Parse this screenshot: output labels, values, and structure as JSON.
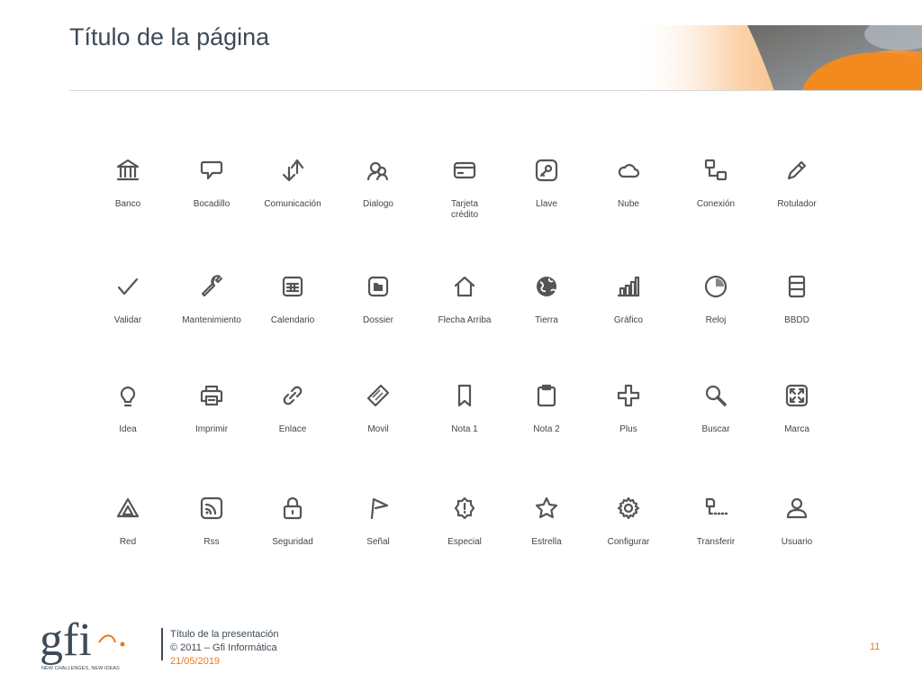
{
  "page": {
    "title": "Título de la página"
  },
  "icons": [
    {
      "label": "Banco",
      "icon": "bank-icon"
    },
    {
      "label": "Bocadillo",
      "icon": "speech-bubble-icon"
    },
    {
      "label": "Comunicación",
      "icon": "communication-icon"
    },
    {
      "label": "Dialogo",
      "icon": "dialog-icon"
    },
    {
      "label": "Tarjeta crédito",
      "icon": "credit-card-icon"
    },
    {
      "label": "Llave",
      "icon": "key-icon"
    },
    {
      "label": "Nube",
      "icon": "cloud-icon"
    },
    {
      "label": "Conexión",
      "icon": "connection-icon"
    },
    {
      "label": "Rotulador",
      "icon": "marker-pen-icon"
    },
    {
      "label": "Validar",
      "icon": "check-icon"
    },
    {
      "label": "Mantenimiento",
      "icon": "wrench-icon"
    },
    {
      "label": "Calendario",
      "icon": "calendar-icon"
    },
    {
      "label": "Dossier",
      "icon": "folder-icon"
    },
    {
      "label": "Flecha Arriba",
      "icon": "home-arrow-up-icon"
    },
    {
      "label": "Tierra",
      "icon": "globe-icon"
    },
    {
      "label": "Gráfico",
      "icon": "bar-chart-icon"
    },
    {
      "label": "Reloj",
      "icon": "clock-icon"
    },
    {
      "label": "BBDD",
      "icon": "database-icon"
    },
    {
      "label": "Idea",
      "icon": "lightbulb-icon"
    },
    {
      "label": "Imprimir",
      "icon": "printer-icon"
    },
    {
      "label": "Enlace",
      "icon": "link-icon"
    },
    {
      "label": "Movil",
      "icon": "mobile-icon"
    },
    {
      "label": "Nota 1",
      "icon": "bookmark-icon"
    },
    {
      "label": "Nota 2",
      "icon": "clipboard-icon"
    },
    {
      "label": "Plus",
      "icon": "plus-icon"
    },
    {
      "label": "Buscar",
      "icon": "search-icon"
    },
    {
      "label": "Marca",
      "icon": "fullscreen-icon"
    },
    {
      "label": "Red",
      "icon": "network-icon"
    },
    {
      "label": "Rss",
      "icon": "rss-icon"
    },
    {
      "label": "Seguridad",
      "icon": "lock-icon"
    },
    {
      "label": "Señal",
      "icon": "signal-flag-icon"
    },
    {
      "label": "Especial",
      "icon": "special-badge-icon"
    },
    {
      "label": "Estrella",
      "icon": "star-icon"
    },
    {
      "label": "Configurar",
      "icon": "gear-icon"
    },
    {
      "label": "Transferir",
      "icon": "transfer-icon"
    },
    {
      "label": "Usuario",
      "icon": "user-icon"
    }
  ],
  "footer": {
    "presentation_title": "Título de la presentación",
    "copyright": "© 2011 – Gfi Informática",
    "date": "21/05/2019",
    "page_number": "11",
    "logo_text": "gfi",
    "logo_tagline": "NEW CHALLENGES, NEW IDEAS"
  },
  "colors": {
    "accent": "#e87b1e",
    "text": "#3d4a57",
    "icon": "#555555"
  }
}
